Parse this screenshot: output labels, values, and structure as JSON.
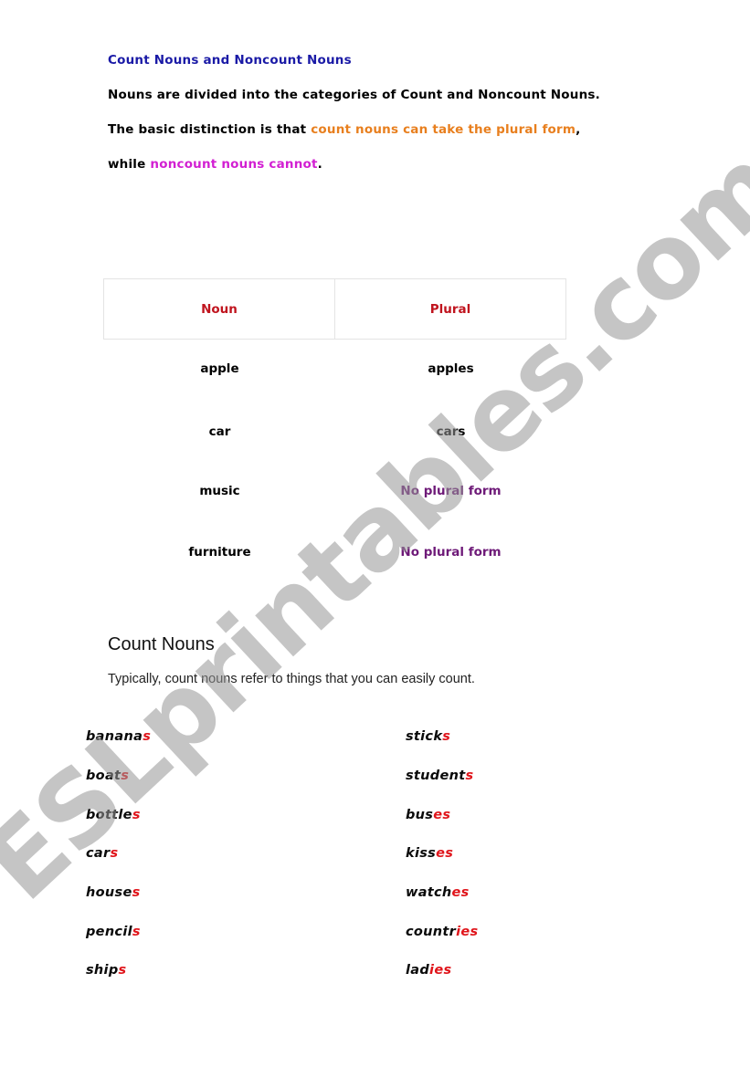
{
  "intro": {
    "title": "Count Nouns and Noncount Nouns",
    "line1": "Nouns are divided into the categories of Count and Noncount Nouns.",
    "line2_prefix": "The basic distinction is that ",
    "line2_highlight": "count nouns can take the plural form",
    "line2_suffix": ",",
    "line3_prefix": "while ",
    "line3_highlight": "noncount nouns cannot",
    "line3_suffix": "."
  },
  "colors": {
    "title": "#1a1aa6",
    "orange_highlight": "#e87f1e",
    "magenta_highlight": "#d21fd2",
    "table_header": "#c0141e",
    "no_plural": "#6e1a78",
    "suffix_red": "#e0151b",
    "watermark": "#969696"
  },
  "table": {
    "headers": [
      "Noun",
      "Plural"
    ],
    "rows": [
      {
        "noun": "apple",
        "plural": "apples"
      },
      {
        "noun": "car",
        "plural": "cars"
      },
      {
        "noun": "music",
        "plural": "No plural form"
      },
      {
        "noun": "furniture",
        "plural": "No plural form"
      }
    ]
  },
  "count_nouns": {
    "heading": "Count Nouns",
    "description": "Typically, count nouns refer to things that you can easily count.",
    "left_words": [
      {
        "stem": "banana",
        "suffix": "s"
      },
      {
        "stem": "boat",
        "suffix": "s"
      },
      {
        "stem": "bottle",
        "suffix": "s"
      },
      {
        "stem": "car",
        "suffix": "s"
      },
      {
        "stem": "house",
        "suffix": "s"
      },
      {
        "stem": "pencil",
        "suffix": "s"
      },
      {
        "stem": "ship",
        "suffix": "s"
      }
    ],
    "right_words": [
      {
        "stem": "stick",
        "suffix": "s"
      },
      {
        "stem": "student",
        "suffix": "s"
      },
      {
        "stem": "bus",
        "suffix": "es"
      },
      {
        "stem": "kiss",
        "suffix": "es"
      },
      {
        "stem": "watch",
        "suffix": "es"
      },
      {
        "stem": "countr",
        "suffix": "ies"
      },
      {
        "stem": "lad",
        "suffix": "ies"
      }
    ]
  },
  "watermark": {
    "text": "ESLprintables.com"
  }
}
